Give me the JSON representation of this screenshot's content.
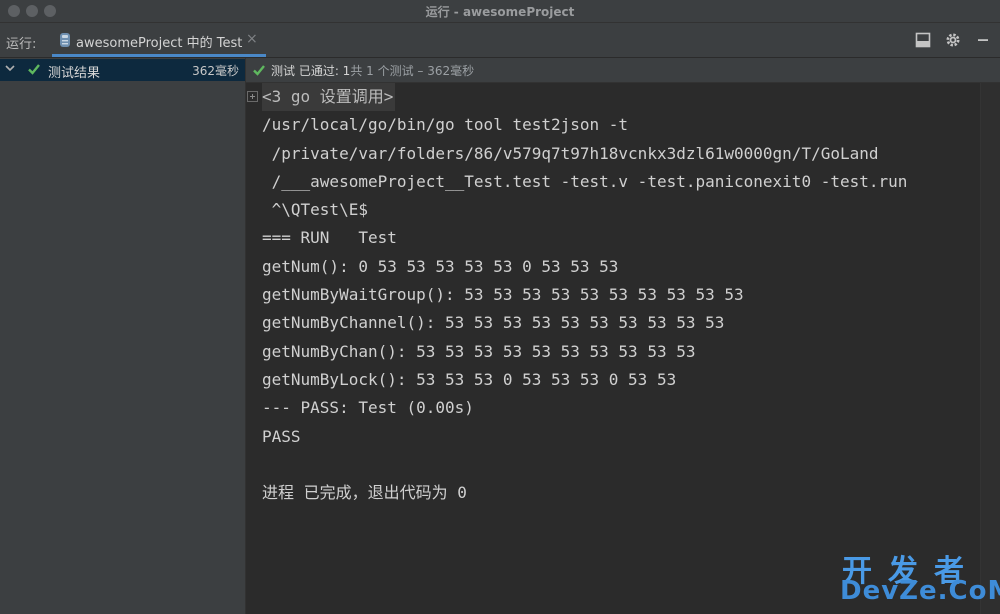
{
  "window": {
    "title": "运行 - awesomeProject"
  },
  "toolbar": {
    "run_label": "运行:",
    "tab_label": "awesomeProject 中的 Test",
    "tab_close": "×"
  },
  "tree": {
    "root_label": "测试结果",
    "root_time": "362毫秒"
  },
  "status": {
    "main": "测试 已通过: 1",
    "count": "共 1 个测试 – 362毫秒"
  },
  "console": {
    "lines": [
      "<3 go 设置调用>",
      "/usr/local/go/bin/go tool test2json -t",
      " /private/var/folders/86/v579q7t97h18vcnkx3dzl61w0000gn/T/GoLand",
      " /___awesomeProject__Test.test -test.v -test.paniconexit0 -test.run",
      " ^\\QTest\\E$",
      "=== RUN   Test",
      "getNum(): 0 53 53 53 53 53 0 53 53 53",
      "getNumByWaitGroup(): 53 53 53 53 53 53 53 53 53 53",
      "getNumByChannel(): 53 53 53 53 53 53 53 53 53 53",
      "getNumByChan(): 53 53 53 53 53 53 53 53 53 53",
      "getNumByLock(): 53 53 53 0 53 53 53 0 53 53",
      "--- PASS: Test (0.00s)",
      "PASS",
      "",
      "进程 已完成，退出代码为 0"
    ]
  },
  "watermark": {
    "top": "开发者",
    "bottom": "DevZe.CoM"
  },
  "icons": {
    "check": "check-icon",
    "chevron": "chevron-down-icon",
    "layout": "layout-icon",
    "gear": "gear-icon",
    "minimize": "minimize-icon",
    "run_config": "go-test-icon"
  },
  "colors": {
    "pass_green": "#5fb85f",
    "accent_blue": "#4a88c7",
    "selection": "#0d293e"
  }
}
